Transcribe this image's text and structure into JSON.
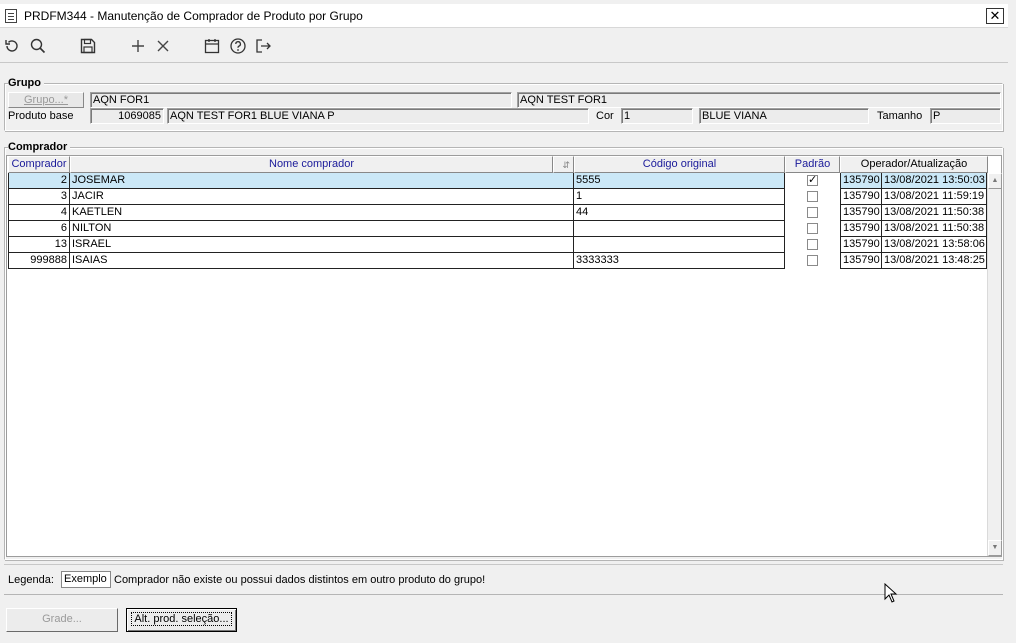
{
  "window": {
    "title": "PRDFM344 - Manutenção de Comprador de Produto por Grupo"
  },
  "toolbar": [
    "refresh-icon",
    "search-icon",
    "save-icon",
    "add-icon",
    "delete-icon",
    "calendar-icon",
    "help-icon",
    "exit-icon"
  ],
  "grupo": {
    "section_label": "Grupo",
    "grupo_button": "Grupo...*",
    "grupo_code": "AQN FOR1",
    "grupo_desc": "AQN TEST FOR1",
    "produto_base_label": "Produto base",
    "produto_code": "1069085",
    "produto_desc": "AQN TEST FOR1 BLUE VIANA P",
    "cor_label": "Cor",
    "cor_code": "1",
    "cor_desc": "BLUE VIANA",
    "tamanho_label": "Tamanho",
    "tamanho_value": "P"
  },
  "comprador": {
    "section_label": "Comprador",
    "columns": {
      "comprador": "Comprador",
      "nome": "Nome comprador",
      "codigo": "Código original",
      "padrao": "Padrão",
      "operador": "Operador/Atualização"
    },
    "rows": [
      {
        "id": "2",
        "nome": "JOSEMAR",
        "codigo": "5555",
        "padrao": true,
        "operador": "135790",
        "data": "13/08/2021 13:50:03"
      },
      {
        "id": "3",
        "nome": "JACIR",
        "codigo": "1",
        "padrao": false,
        "operador": "135790",
        "data": "13/08/2021 11:59:19"
      },
      {
        "id": "4",
        "nome": "KAETLEN",
        "codigo": "44",
        "padrao": false,
        "operador": "135790",
        "data": "13/08/2021 11:50:38"
      },
      {
        "id": "6",
        "nome": "NILTON",
        "codigo": "",
        "padrao": false,
        "operador": "135790",
        "data": "13/08/2021 11:50:38"
      },
      {
        "id": "13",
        "nome": "ISRAEL",
        "codigo": "",
        "padrao": false,
        "operador": "135790",
        "data": "13/08/2021 13:58:06"
      },
      {
        "id": "999888",
        "nome": "ISAIAS",
        "codigo": "3333333",
        "padrao": false,
        "operador": "135790",
        "data": "13/08/2021 13:48:25"
      }
    ]
  },
  "legend": {
    "label": "Legenda:",
    "example": "Exemplo",
    "text": "Comprador não existe ou possui dados distintos em outro produto do grupo!"
  },
  "buttons": {
    "grade": "Grade...",
    "alt_prod": "Alt. prod. seleção..."
  }
}
